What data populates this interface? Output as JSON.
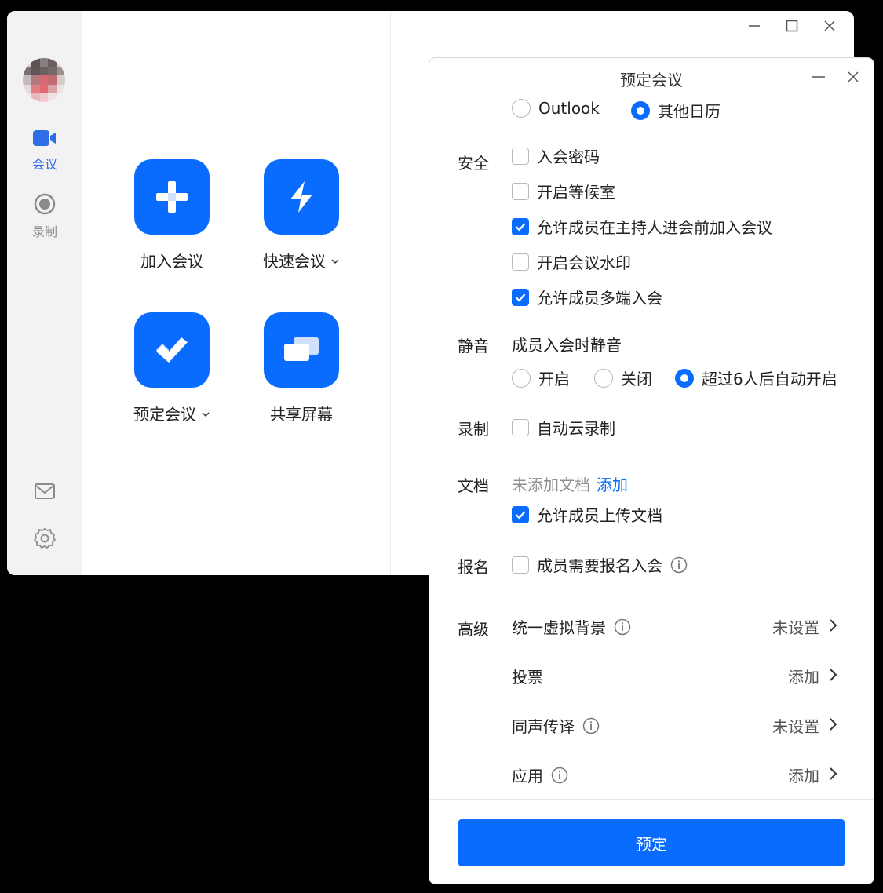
{
  "sidebar": {
    "nav": [
      {
        "label": "会议",
        "icon": "video-camera-icon",
        "active": true
      },
      {
        "label": "录制",
        "icon": "record-icon",
        "active": false
      }
    ],
    "bottom_icons": [
      "mail-icon",
      "gear-icon"
    ]
  },
  "actions": {
    "join": "加入会议",
    "quick": "快速会议",
    "schedule": "预定会议",
    "share": "共享屏幕"
  },
  "dialog": {
    "title": "预定会议",
    "calendar": {
      "options": [
        "Outlook",
        "其他日历"
      ],
      "selected": "其他日历"
    },
    "security": {
      "label": "安全",
      "items": [
        {
          "label": "入会密码",
          "checked": false
        },
        {
          "label": "开启等候室",
          "checked": false
        },
        {
          "label": "允许成员在主持人进会前加入会议",
          "checked": true
        },
        {
          "label": "开启会议水印",
          "checked": false
        },
        {
          "label": "允许成员多端入会",
          "checked": true
        }
      ]
    },
    "mute": {
      "label": "静音",
      "subtitle": "成员入会时静音",
      "options": [
        "开启",
        "关闭",
        "超过6人后自动开启"
      ],
      "selected": "超过6人后自动开启"
    },
    "record": {
      "label": "录制",
      "option": "自动云录制",
      "checked": false
    },
    "docs": {
      "label": "文档",
      "empty_text": "未添加文档",
      "add_link": "添加",
      "option": "允许成员上传文档",
      "checked": true
    },
    "register": {
      "label": "报名",
      "option": "成员需要报名入会",
      "checked": false
    },
    "advanced": {
      "label": "高级",
      "items": [
        {
          "label": "统一虚拟背景",
          "value": "未设置",
          "info": true
        },
        {
          "label": "投票",
          "value": "添加",
          "info": false
        },
        {
          "label": "同声传译",
          "value": "未设置",
          "info": true
        },
        {
          "label": "应用",
          "value": "添加",
          "info": true
        }
      ]
    },
    "submit": "预定"
  },
  "colors": {
    "accent": "#0a6cff",
    "sidebar_bg": "#f2f2f3"
  }
}
